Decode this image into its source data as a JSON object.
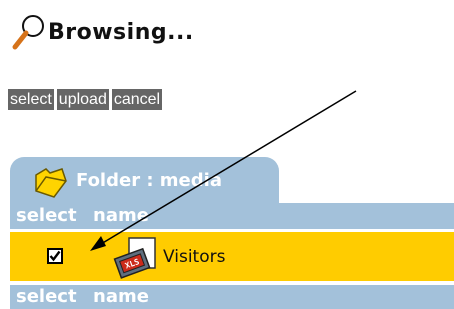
{
  "page": {
    "title": "Browsing..."
  },
  "actions": {
    "select_label": "select",
    "upload_label": "upload",
    "cancel_label": "cancel"
  },
  "folder": {
    "tab_label": "Folder : media"
  },
  "table": {
    "columns": [
      "select",
      "name"
    ],
    "rows": [
      {
        "checked": true,
        "name": "Visitors",
        "icon": "xls-file-icon"
      }
    ]
  },
  "colors": {
    "header_bg": "#a3c1da",
    "selected_row_bg": "#ffcc00",
    "button_bg": "#666666"
  }
}
